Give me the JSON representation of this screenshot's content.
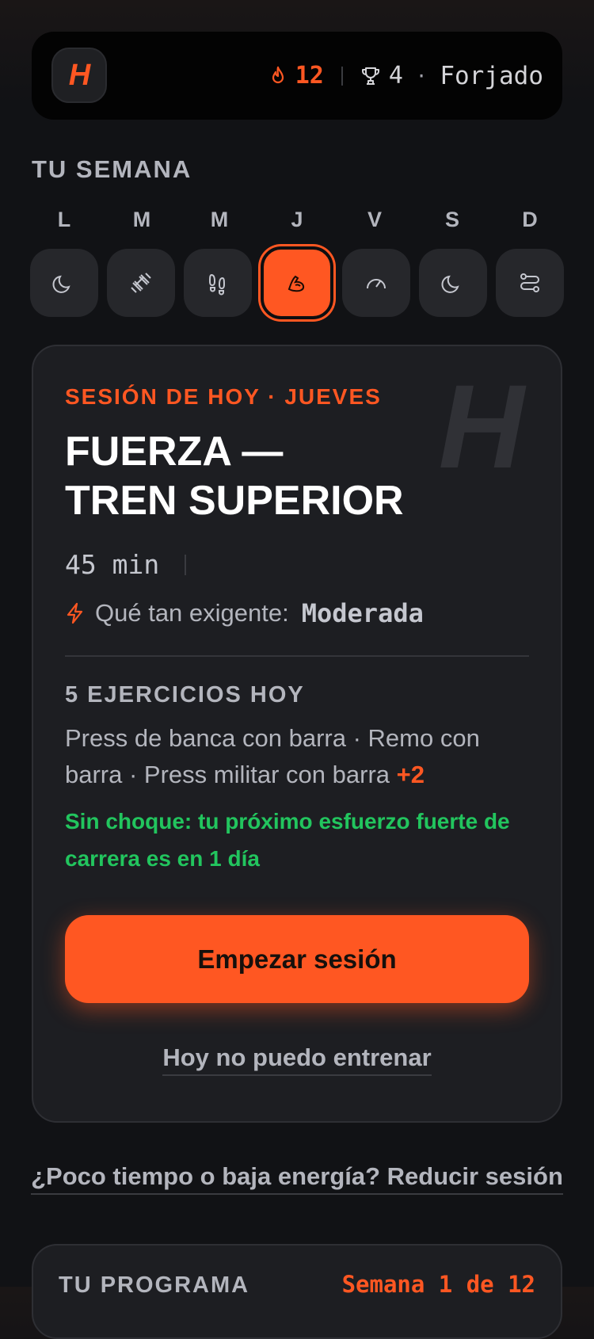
{
  "header": {
    "logo_letter": "H",
    "streak": "12",
    "trophies": "4",
    "separator": "·",
    "rank": "Forjado"
  },
  "week": {
    "title": "TU SEMANA",
    "days": [
      {
        "letter": "L",
        "icon": "moon-icon"
      },
      {
        "letter": "M",
        "icon": "dumbbell-icon"
      },
      {
        "letter": "M",
        "icon": "footprints-icon"
      },
      {
        "letter": "J",
        "icon": "bicep-icon",
        "active": true
      },
      {
        "letter": "V",
        "icon": "speedometer-icon"
      },
      {
        "letter": "S",
        "icon": "moon-icon"
      },
      {
        "letter": "D",
        "icon": "route-icon"
      }
    ]
  },
  "session": {
    "label": "SESIÓN DE HOY · JUEVES",
    "watermark": "H",
    "title_line1": "FUERZA —",
    "title_line2": "TREN SUPERIOR",
    "duration": "45 min",
    "demand_label": "Qué tan exigente:",
    "demand_value": "Moderada",
    "exercise_count": "5 EJERCICIOS HOY",
    "exercise_list": "Press de banca con barra · Remo con barra · Press militar con barra",
    "exercise_more": "+2",
    "no_clash": "Sin choque: tu próximo esfuerzo fuerte de carrera es en 1 día",
    "start_button": "Empezar sesión",
    "skip_link": "Hoy no puedo entrenar"
  },
  "reduce_link": "¿Poco tiempo o baja energía? Reducir sesión",
  "program": {
    "title": "TU PROGRAMA",
    "week": "Semana 1 de 12"
  },
  "colors": {
    "accent": "#ff5722",
    "success": "#22c55e",
    "card": "#1d1e22",
    "background": "#111215"
  }
}
